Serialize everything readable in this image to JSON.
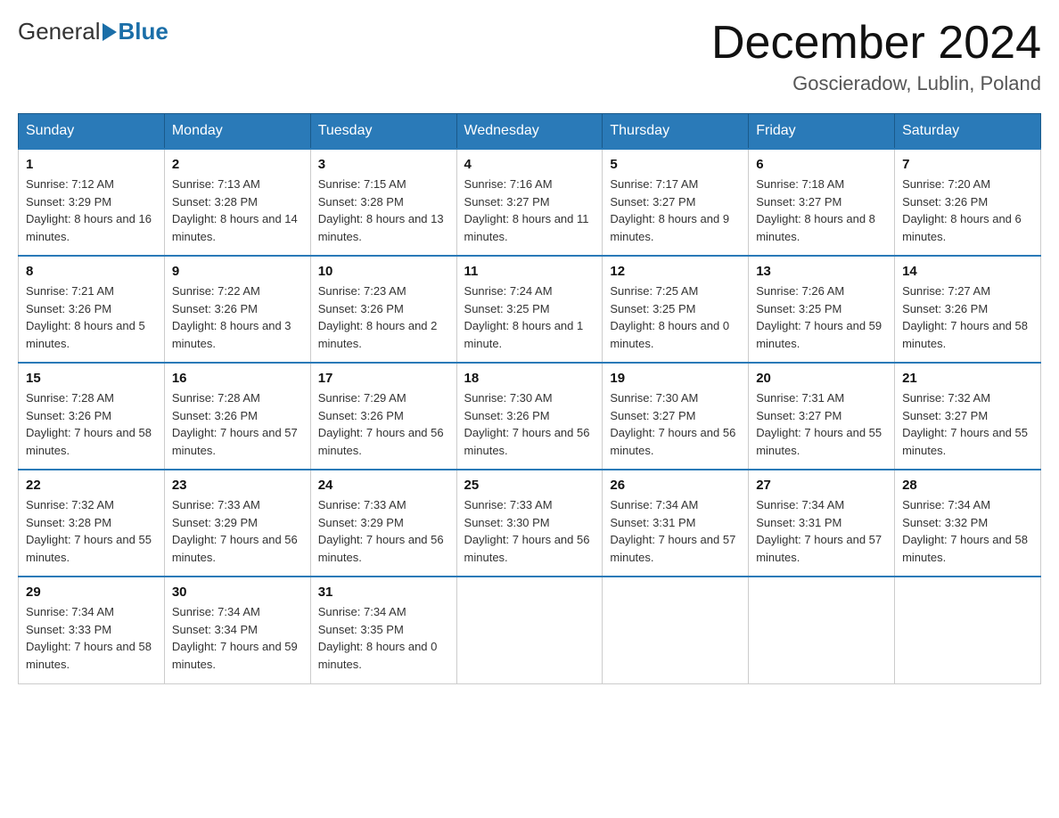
{
  "header": {
    "logo_general": "General",
    "logo_blue": "Blue",
    "month_title": "December 2024",
    "location": "Goscieradow, Lublin, Poland"
  },
  "days_of_week": [
    "Sunday",
    "Monday",
    "Tuesday",
    "Wednesday",
    "Thursday",
    "Friday",
    "Saturday"
  ],
  "weeks": [
    [
      {
        "day": "1",
        "sunrise": "7:12 AM",
        "sunset": "3:29 PM",
        "daylight": "8 hours and 16 minutes."
      },
      {
        "day": "2",
        "sunrise": "7:13 AM",
        "sunset": "3:28 PM",
        "daylight": "8 hours and 14 minutes."
      },
      {
        "day": "3",
        "sunrise": "7:15 AM",
        "sunset": "3:28 PM",
        "daylight": "8 hours and 13 minutes."
      },
      {
        "day": "4",
        "sunrise": "7:16 AM",
        "sunset": "3:27 PM",
        "daylight": "8 hours and 11 minutes."
      },
      {
        "day": "5",
        "sunrise": "7:17 AM",
        "sunset": "3:27 PM",
        "daylight": "8 hours and 9 minutes."
      },
      {
        "day": "6",
        "sunrise": "7:18 AM",
        "sunset": "3:27 PM",
        "daylight": "8 hours and 8 minutes."
      },
      {
        "day": "7",
        "sunrise": "7:20 AM",
        "sunset": "3:26 PM",
        "daylight": "8 hours and 6 minutes."
      }
    ],
    [
      {
        "day": "8",
        "sunrise": "7:21 AM",
        "sunset": "3:26 PM",
        "daylight": "8 hours and 5 minutes."
      },
      {
        "day": "9",
        "sunrise": "7:22 AM",
        "sunset": "3:26 PM",
        "daylight": "8 hours and 3 minutes."
      },
      {
        "day": "10",
        "sunrise": "7:23 AM",
        "sunset": "3:26 PM",
        "daylight": "8 hours and 2 minutes."
      },
      {
        "day": "11",
        "sunrise": "7:24 AM",
        "sunset": "3:25 PM",
        "daylight": "8 hours and 1 minute."
      },
      {
        "day": "12",
        "sunrise": "7:25 AM",
        "sunset": "3:25 PM",
        "daylight": "8 hours and 0 minutes."
      },
      {
        "day": "13",
        "sunrise": "7:26 AM",
        "sunset": "3:25 PM",
        "daylight": "7 hours and 59 minutes."
      },
      {
        "day": "14",
        "sunrise": "7:27 AM",
        "sunset": "3:26 PM",
        "daylight": "7 hours and 58 minutes."
      }
    ],
    [
      {
        "day": "15",
        "sunrise": "7:28 AM",
        "sunset": "3:26 PM",
        "daylight": "7 hours and 58 minutes."
      },
      {
        "day": "16",
        "sunrise": "7:28 AM",
        "sunset": "3:26 PM",
        "daylight": "7 hours and 57 minutes."
      },
      {
        "day": "17",
        "sunrise": "7:29 AM",
        "sunset": "3:26 PM",
        "daylight": "7 hours and 56 minutes."
      },
      {
        "day": "18",
        "sunrise": "7:30 AM",
        "sunset": "3:26 PM",
        "daylight": "7 hours and 56 minutes."
      },
      {
        "day": "19",
        "sunrise": "7:30 AM",
        "sunset": "3:27 PM",
        "daylight": "7 hours and 56 minutes."
      },
      {
        "day": "20",
        "sunrise": "7:31 AM",
        "sunset": "3:27 PM",
        "daylight": "7 hours and 55 minutes."
      },
      {
        "day": "21",
        "sunrise": "7:32 AM",
        "sunset": "3:27 PM",
        "daylight": "7 hours and 55 minutes."
      }
    ],
    [
      {
        "day": "22",
        "sunrise": "7:32 AM",
        "sunset": "3:28 PM",
        "daylight": "7 hours and 55 minutes."
      },
      {
        "day": "23",
        "sunrise": "7:33 AM",
        "sunset": "3:29 PM",
        "daylight": "7 hours and 56 minutes."
      },
      {
        "day": "24",
        "sunrise": "7:33 AM",
        "sunset": "3:29 PM",
        "daylight": "7 hours and 56 minutes."
      },
      {
        "day": "25",
        "sunrise": "7:33 AM",
        "sunset": "3:30 PM",
        "daylight": "7 hours and 56 minutes."
      },
      {
        "day": "26",
        "sunrise": "7:34 AM",
        "sunset": "3:31 PM",
        "daylight": "7 hours and 57 minutes."
      },
      {
        "day": "27",
        "sunrise": "7:34 AM",
        "sunset": "3:31 PM",
        "daylight": "7 hours and 57 minutes."
      },
      {
        "day": "28",
        "sunrise": "7:34 AM",
        "sunset": "3:32 PM",
        "daylight": "7 hours and 58 minutes."
      }
    ],
    [
      {
        "day": "29",
        "sunrise": "7:34 AM",
        "sunset": "3:33 PM",
        "daylight": "7 hours and 58 minutes."
      },
      {
        "day": "30",
        "sunrise": "7:34 AM",
        "sunset": "3:34 PM",
        "daylight": "7 hours and 59 minutes."
      },
      {
        "day": "31",
        "sunrise": "7:34 AM",
        "sunset": "3:35 PM",
        "daylight": "8 hours and 0 minutes."
      },
      null,
      null,
      null,
      null
    ]
  ]
}
